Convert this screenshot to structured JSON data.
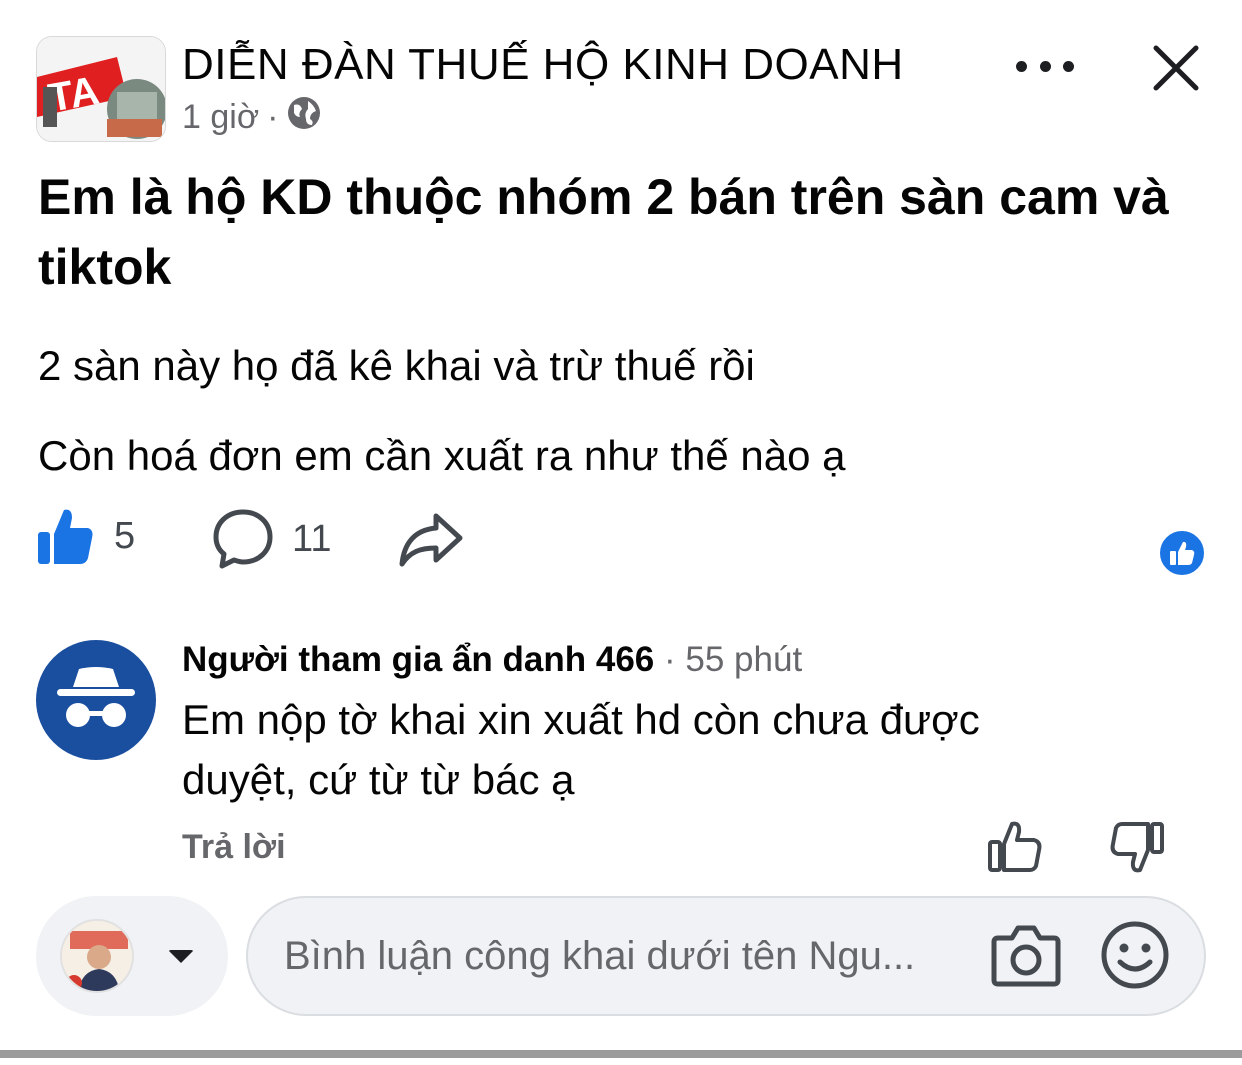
{
  "post": {
    "group_name": "DIỄN ĐÀN THUẾ HỘ KINH DOANH",
    "time": "1 giờ",
    "separator": "·",
    "title": "Em là hộ KD thuộc nhóm 2 bán trên sàn cam và tiktok",
    "body_lines": [
      "2 sàn này họ đã kê khai và trừ thuế rồi",
      "Còn hoá đơn em cần xuất ra như thế nào ạ"
    ],
    "like_count": "5",
    "comment_count": "11"
  },
  "comment": {
    "author": "Người tham gia ẩn danh 466",
    "separator": "·",
    "time": "55 phút",
    "text": "Em nộp tờ khai xin xuất hd còn chưa được duyệt, cứ từ từ bác ạ",
    "reply_label": "Trả lời"
  },
  "composer": {
    "placeholder": "Bình luận công khai dưới tên Ngu..."
  },
  "icons": {
    "more": "more-horizontal-icon",
    "close": "close-icon",
    "globe": "globe-icon",
    "like": "thumbs-up-filled-icon",
    "comment": "comment-bubble-icon",
    "share": "share-arrow-icon",
    "like_badge": "like-reaction-icon",
    "anonymous": "anonymous-incognito-icon",
    "upvote": "thumbs-up-outline-icon",
    "downvote": "thumbs-down-outline-icon",
    "camera": "camera-icon",
    "emoji": "emoji-smile-icon",
    "dropdown": "caret-down-icon"
  },
  "colors": {
    "brand_blue": "#1b74e4",
    "anon_avatar": "#1a4fa0",
    "secondary_text": "#65676b",
    "input_bg": "#f0f2f5"
  }
}
